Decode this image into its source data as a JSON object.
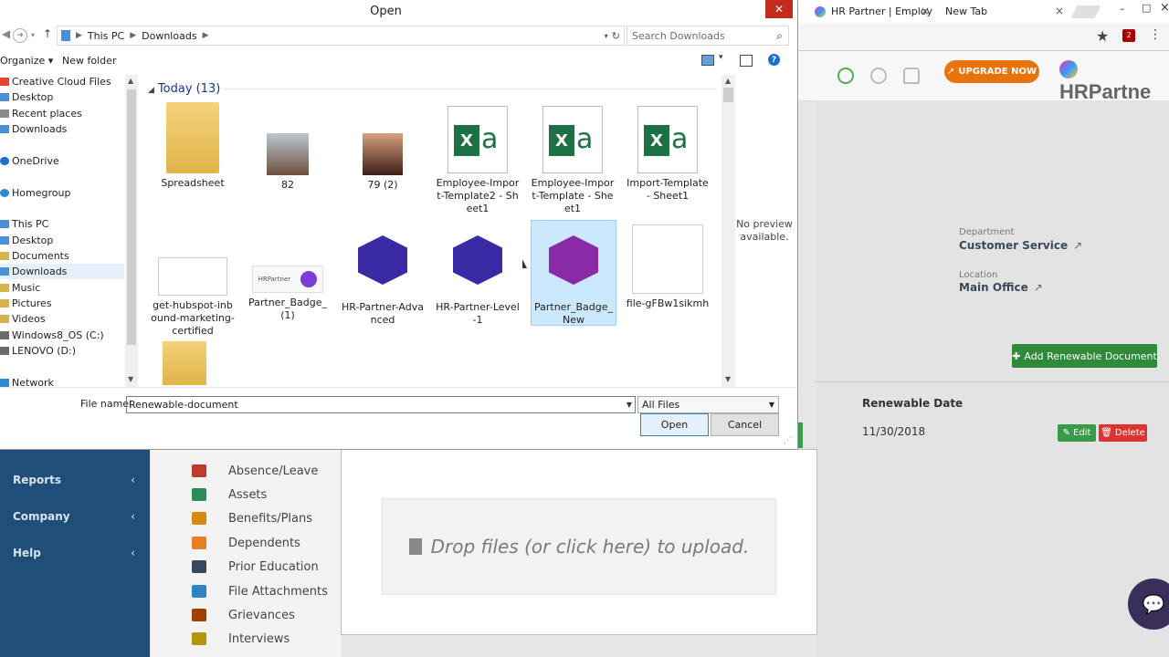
{
  "chrome": {
    "tabs": [
      {
        "title": "HR Partner | Employ",
        "close": "×"
      },
      {
        "title": "New Tab",
        "close": "×"
      }
    ],
    "star_icon": "★",
    "ext_badge": "2",
    "kebab": "⋮",
    "window_controls": {
      "minimize": "–",
      "maximize": "□",
      "close": "×"
    }
  },
  "app": {
    "upgrade_label": "UPGRADE NOW",
    "brand": "HRPartne",
    "department_label": "Department",
    "department_value": "Customer Service",
    "location_label": "Location",
    "location_value": "Main Office",
    "add_renewable_label": "Add Renewable Document",
    "renewable_header": "Renewable Date",
    "renewable_date": "11/30/2018",
    "edit_label": "Edit",
    "delete_label": "Delete"
  },
  "left_nav": [
    "Reports",
    "Company",
    "Help"
  ],
  "submenu": [
    {
      "label": "Absence/Leave",
      "color": "#c0392b"
    },
    {
      "label": "Assets",
      "color": "#2e8b57"
    },
    {
      "label": "Benefits/Plans",
      "color": "#d68910"
    },
    {
      "label": "Dependents",
      "color": "#e67e22"
    },
    {
      "label": "Prior Education",
      "color": "#34495e"
    },
    {
      "label": "File Attachments",
      "color": "#2e86c1"
    },
    {
      "label": "Grievances",
      "color": "#a04000"
    },
    {
      "label": "Interviews",
      "color": "#b7950b"
    }
  ],
  "upload": {
    "drop_text": "Drop files (or click here) to upload."
  },
  "dialog": {
    "title": "Open",
    "close": "✕",
    "breadcrumb": [
      "This PC",
      "Downloads"
    ],
    "search_placeholder": "Search Downloads",
    "organize": "Organize ▾",
    "new_folder": "New folder",
    "help": "?",
    "nav_items": [
      {
        "label": "Creative Cloud Files",
        "icon": "#e9442a"
      },
      {
        "label": "Desktop",
        "icon": "#4a90d9"
      },
      {
        "label": "Recent places",
        "icon": "#8a8a8a"
      },
      {
        "label": "Downloads",
        "icon": "#4a90d9"
      },
      {
        "label": "OneDrive",
        "icon": "#1e6fcf"
      },
      {
        "label": "Homegroup",
        "icon": "#2b8bd6"
      },
      {
        "label": "This PC",
        "icon": "#4a90d9"
      },
      {
        "label": "Desktop",
        "icon": "#4a90d9"
      },
      {
        "label": "Documents",
        "icon": "#d9b34a"
      },
      {
        "label": "Downloads",
        "icon": "#4a90d9"
      },
      {
        "label": "Music",
        "icon": "#d9b34a"
      },
      {
        "label": "Pictures",
        "icon": "#d9b34a"
      },
      {
        "label": "Videos",
        "icon": "#d9b34a"
      },
      {
        "label": "Windows8_OS (C:)",
        "icon": "#6b6b6b"
      },
      {
        "label": "LENOVO (D:)",
        "icon": "#6b6b6b"
      },
      {
        "label": "Network",
        "icon": "#2b8bd6"
      }
    ],
    "group_label": "Today (13)",
    "files": [
      {
        "name": "Spreadsheet",
        "kind": "folder"
      },
      {
        "name": "82",
        "kind": "photo-m"
      },
      {
        "name": "79 (2)",
        "kind": "photo-f"
      },
      {
        "name": "Employee-Import-Template2 - Sheet1",
        "kind": "excel"
      },
      {
        "name": "Employee-Import-Template - Sheet1",
        "kind": "excel"
      },
      {
        "name": "Import-Template - Sheet1",
        "kind": "excel"
      },
      {
        "name": "get-hubspot-inbound-marketing-certified",
        "kind": "cert"
      },
      {
        "name": "Partner_Badge_(1)",
        "kind": "badge-wide"
      },
      {
        "name": "HR-Partner-Advanced",
        "kind": "hex"
      },
      {
        "name": "HR-Partner-Level-1",
        "kind": "hex"
      },
      {
        "name": "Partner_Badge_New",
        "kind": "hex-mag"
      },
      {
        "name": "file-gFBw1sikmh",
        "kind": "form"
      }
    ],
    "preview_text": "No preview available.",
    "filename_label": "File name:",
    "filename_value": "Renewable-document",
    "filetype_value": "All Files",
    "open_label": "Open",
    "cancel_label": "Cancel"
  }
}
